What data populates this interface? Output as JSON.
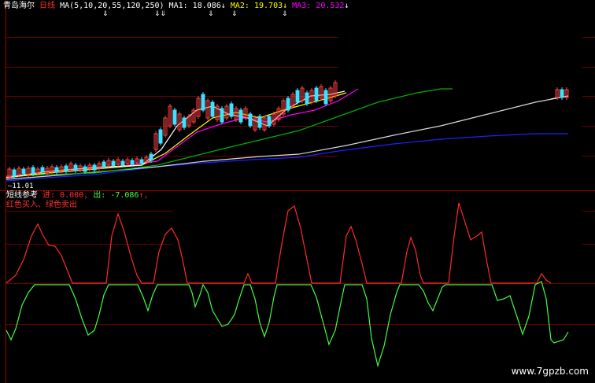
{
  "header": {
    "stock_name": "青岛海尔",
    "period": "日线",
    "ma_params": "MA(5,10,20,55,120,250)",
    "ma1_label": "MA1:",
    "ma1_value": "18.086",
    "ma1_arrow": "↓",
    "ma2_label": "MA2:",
    "ma2_value": "19.703",
    "ma2_arrow": "↓",
    "ma3_label": "MA3:",
    "ma3_value": "20.532",
    "ma3_arrow": "↓"
  },
  "price_panel": {
    "date_marker": "11.01"
  },
  "indicator": {
    "title": "短线参考",
    "in_label": "进:",
    "in_value": "0.000,",
    "out_label": "出:",
    "out_value": "-7.086",
    "out_arrow": "↑,",
    "legend_text": "红色买入、绿色卖出"
  },
  "colors": {
    "background": "#000000",
    "up_candle": "#ff4040",
    "down_candle": "#40e0ff",
    "ma1": "#ffffff",
    "ma2": "#ffff00",
    "ma3": "#ff00ff",
    "ma4": "#00cc00",
    "ma5": "#c8c8c8",
    "ma6": "#0000ff",
    "buy_line": "#ff2020",
    "sell_line": "#40ff40",
    "grid": "#800000"
  },
  "watermark": "www.7gpzb.com"
}
